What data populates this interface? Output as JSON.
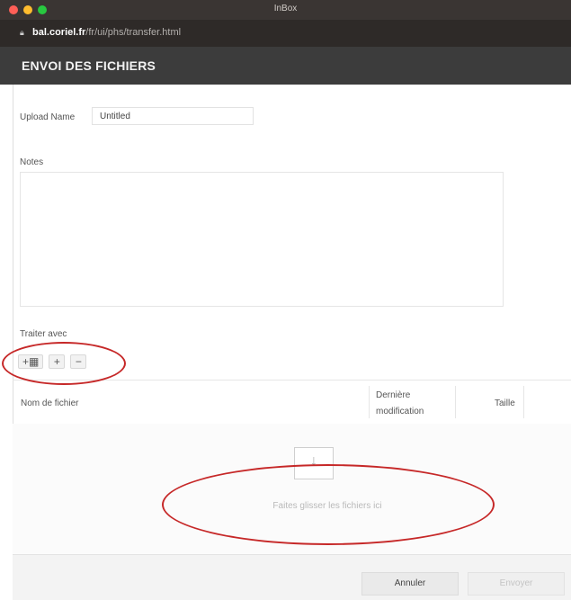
{
  "window": {
    "title": "InBox"
  },
  "browser": {
    "url_host": "bal.coriel.fr",
    "url_path": "/fr/ui/phs/transfer.html"
  },
  "header": {
    "title": "ENVOI DES FICHIERS"
  },
  "form": {
    "upload_name_label": "Upload Name",
    "upload_name_value": "Untitled",
    "notes_label": "Notes",
    "toolbar_label": "Traiter avec",
    "buttons": [
      "+▦",
      "+",
      "−"
    ]
  },
  "table": {
    "col_name": "Nom de fichier",
    "col_date_line1": "Dernière",
    "col_date_line2": "modification",
    "col_size": "Taille"
  },
  "dropzone": {
    "text": "Faites glisser les fichiers ici"
  },
  "footer": {
    "cancel_label": "Annuler",
    "send_label": "Envoyer"
  },
  "annotations": {
    "color": "#c62828"
  }
}
